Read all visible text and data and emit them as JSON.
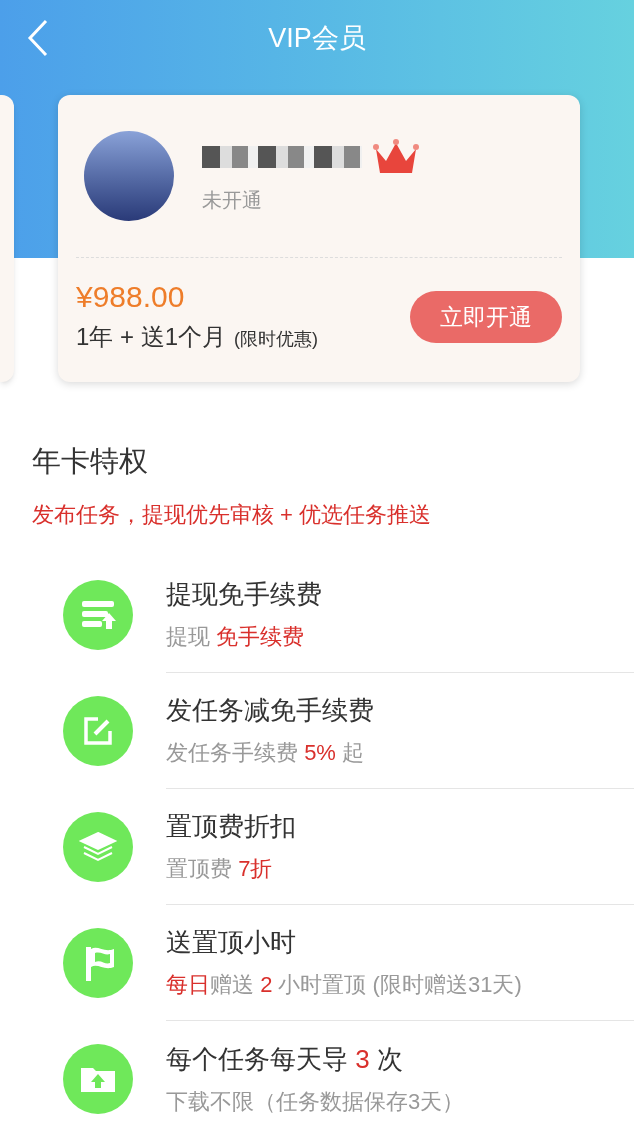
{
  "header": {
    "title": "VIP会员"
  },
  "card": {
    "status": "未开通",
    "price": "¥988.00",
    "plan": "1年 + 送1个月",
    "plan_note": "(限时优惠)",
    "button": "立即开通"
  },
  "section": {
    "title": "年卡特权",
    "subtitle": "发布任务，提现优先审核 + 优选任务推送"
  },
  "privileges": [
    {
      "kind": "withdraw",
      "title": [
        {
          "text": "提现免手续费",
          "highlight": false
        }
      ],
      "detail": [
        {
          "text": "提现 ",
          "highlight": false
        },
        {
          "text": "免手续费",
          "highlight": true
        }
      ]
    },
    {
      "kind": "edit",
      "title": [
        {
          "text": "发任务减免手续费",
          "highlight": false
        }
      ],
      "detail": [
        {
          "text": "发任务手续费 ",
          "highlight": false
        },
        {
          "text": "5%",
          "highlight": true
        },
        {
          "text": " 起",
          "highlight": false
        }
      ]
    },
    {
      "kind": "layers",
      "title": [
        {
          "text": "置顶费折扣",
          "highlight": false
        }
      ],
      "detail": [
        {
          "text": "置顶费 ",
          "highlight": false
        },
        {
          "text": "7折",
          "highlight": true
        }
      ]
    },
    {
      "kind": "flag",
      "title": [
        {
          "text": "送置顶小时",
          "highlight": false
        }
      ],
      "detail": [
        {
          "text": "每日",
          "highlight": true
        },
        {
          "text": "赠送 ",
          "highlight": false
        },
        {
          "text": "2",
          "highlight": true
        },
        {
          "text": " 小时置顶 (限时赠送31天)",
          "highlight": false
        }
      ]
    },
    {
      "kind": "folder",
      "title": [
        {
          "text": "每个任务每天导 ",
          "highlight": false
        },
        {
          "text": "3",
          "highlight": true
        },
        {
          "text": " 次",
          "highlight": false
        }
      ],
      "detail": [
        {
          "text": "下载不限（任务数据保存3天）",
          "highlight": false
        }
      ]
    }
  ]
}
